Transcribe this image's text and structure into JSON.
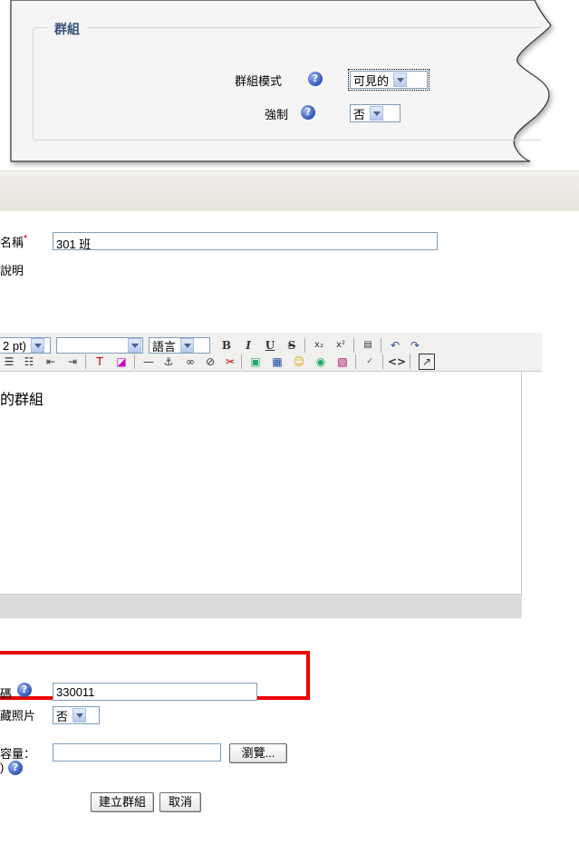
{
  "group_panel": {
    "legend": "群組",
    "group_mode_label": "群組模式",
    "group_mode_value": "可見的",
    "force_label": "強制",
    "force_value": "否",
    "help_icon": "?"
  },
  "form": {
    "name_label": "名稱",
    "required_mark": "*",
    "name_value": "301 班",
    "description_label": "說明",
    "toolbar": {
      "font_size_value": "2 pt)",
      "format_value": "",
      "language_value": "語言"
    },
    "editor_content": "的群組",
    "enrolment_key_label": "碼",
    "enrolment_key_value": "330011",
    "hide_picture_label": "藏照片",
    "hide_picture_value": "否",
    "new_picture_label": "容量：",
    "new_picture_sub": ")",
    "browse_label": "瀏覽...",
    "create_button": "建立群組",
    "cancel_button": "取消"
  },
  "colors": {
    "legend": "#35537a",
    "highlight": "#ee0000",
    "header_bg": "#e7e4dd"
  }
}
